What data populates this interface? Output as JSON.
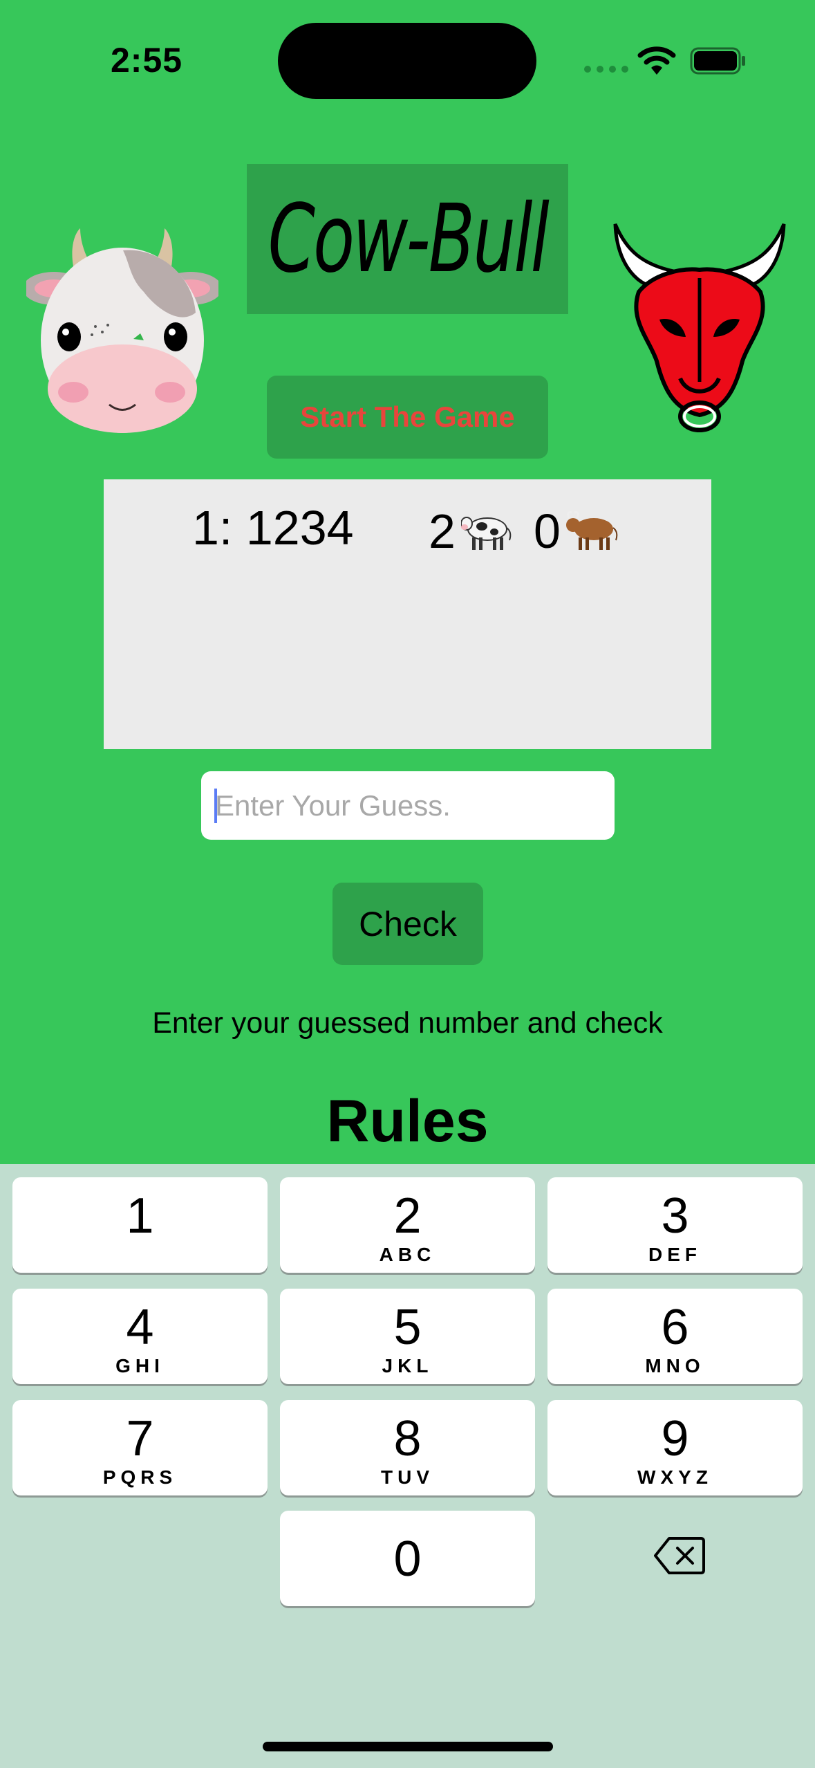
{
  "status_bar": {
    "time": "2:55"
  },
  "header": {
    "title": "Cow-Bull",
    "start_button": "Start The Game"
  },
  "history": [
    {
      "guess": "1: 1234",
      "cows": "2",
      "cow_emoji": "🐄",
      "bulls": "0",
      "bull_emoji": "🐂"
    }
  ],
  "guess_input": {
    "placeholder": "Enter Your Guess.",
    "value": ""
  },
  "check_button": "Check",
  "status_message": "Enter your guessed number and check",
  "rules_heading": "Rules",
  "keyboard": {
    "keys": [
      {
        "digit": "1",
        "letters": ""
      },
      {
        "digit": "2",
        "letters": "ABC"
      },
      {
        "digit": "3",
        "letters": "DEF"
      },
      {
        "digit": "4",
        "letters": "GHI"
      },
      {
        "digit": "5",
        "letters": "JKL"
      },
      {
        "digit": "6",
        "letters": "MNO"
      },
      {
        "digit": "7",
        "letters": "PQRS"
      },
      {
        "digit": "8",
        "letters": "TUV"
      },
      {
        "digit": "9",
        "letters": "WXYZ"
      },
      {
        "digit": "0",
        "letters": ""
      }
    ]
  },
  "colors": {
    "background": "#37c75a",
    "button": "#2ea24b",
    "start_text": "#e8453c",
    "panel": "#ebebeb",
    "keyboard": "#c0ddcf"
  },
  "icons": [
    "wifi-icon",
    "battery-icon",
    "cow-face-icon",
    "bull-head-icon",
    "delete-key-icon"
  ]
}
